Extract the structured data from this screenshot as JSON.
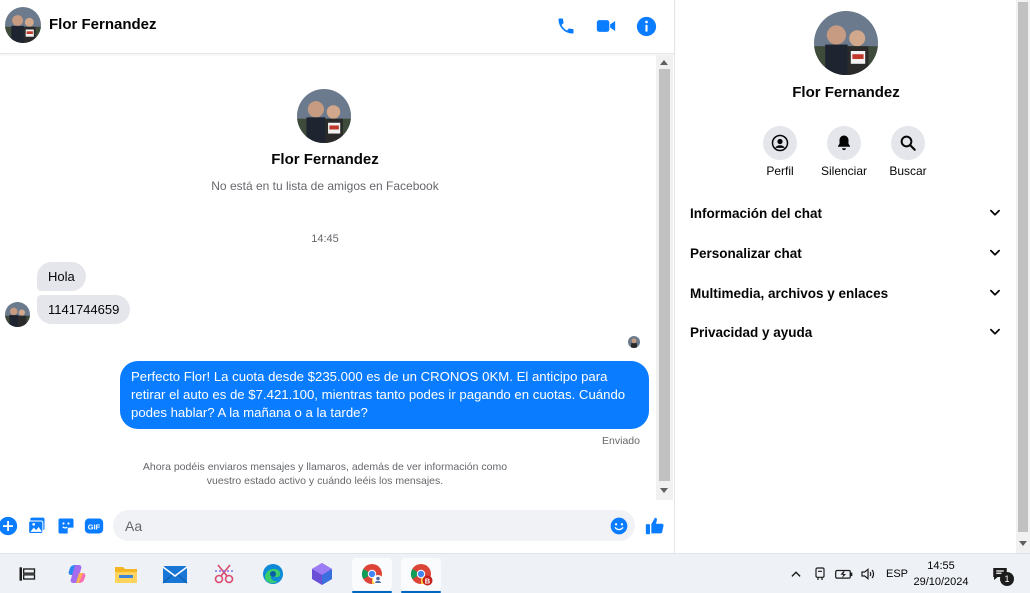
{
  "contact": {
    "name": "Flor Fernandez",
    "subtitle": "No está en tu lista de amigos en Facebook"
  },
  "header": {
    "name": "Flor Fernandez",
    "icons": [
      "phone-icon",
      "video-camera-icon",
      "info-icon"
    ]
  },
  "messages": {
    "timestamp": "14:45",
    "incoming": [
      "Hola",
      "1141744659"
    ],
    "outgoing": "Perfecto Flor! La cuota desde $235.000 es de un CRONOS 0KM. El anticipo para retirar el auto es de $7.421.100, mientras tanto podes ir pagando en cuotas. Cuándo podes hablar? A la mañana o a la tarde?",
    "status": "Enviado",
    "notice": "Ahora podéis enviaros mensajes y llamaros, además de ver información como vuestro estado activo y cuándo leéis los mensajes."
  },
  "composer": {
    "placeholder": "Aa",
    "icons": [
      "plus-icon",
      "photo-icon",
      "sticker-icon",
      "gif-icon",
      "emoji-icon",
      "like-icon"
    ],
    "gif_label": "GIF"
  },
  "info_panel": {
    "name": "Flor Fernandez",
    "actions": [
      {
        "label": "Perfil",
        "icon": "profile-icon"
      },
      {
        "label": "Silenciar",
        "icon": "bell-icon"
      },
      {
        "label": "Buscar",
        "icon": "search-icon"
      }
    ],
    "sections": [
      "Información del chat",
      "Personalizar chat",
      "Multimedia, archivos y enlaces",
      "Privacidad y ayuda"
    ]
  },
  "taskbar": {
    "apps": [
      "task-view-icon",
      "copilot-icon",
      "file-explorer-icon",
      "mail-icon",
      "snipping-tool-icon",
      "edge-icon",
      "copilot-app-icon",
      "chrome-profile-icon",
      "chrome-icon"
    ],
    "language": "ESP",
    "time": "14:55",
    "date": "29/10/2024",
    "notification_count": "1",
    "chrome_badge": "B"
  },
  "colors": {
    "accent": "#0a7cff",
    "bubble_in": "#e4e6eb",
    "muted_text": "#65676b",
    "action_bg": "#e4e6eb"
  }
}
